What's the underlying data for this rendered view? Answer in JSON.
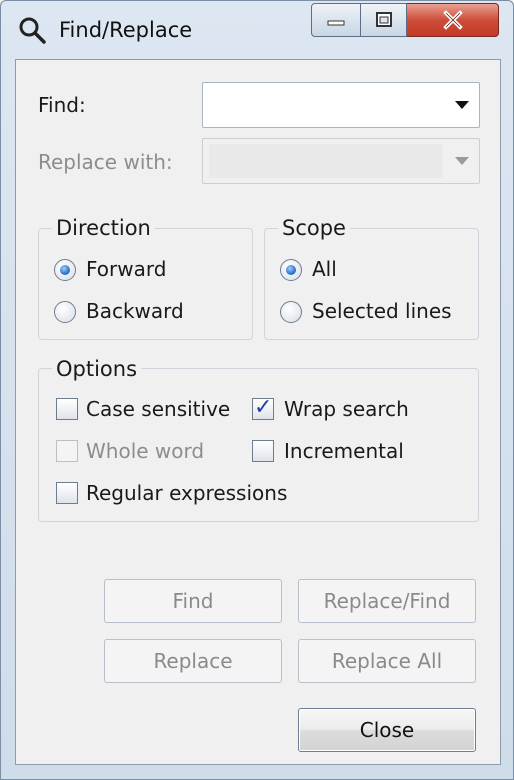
{
  "window": {
    "title": "Find/Replace",
    "title_icon": "search-icon",
    "caption_buttons": [
      "minimize-icon",
      "maximize-icon",
      "close-icon"
    ]
  },
  "find": {
    "label": "Find:",
    "value": ""
  },
  "replace": {
    "label": "Replace with:",
    "value": ""
  },
  "direction": {
    "title": "Direction",
    "options": [
      {
        "label": "Forward",
        "checked": true
      },
      {
        "label": "Backward",
        "checked": false
      }
    ]
  },
  "scope": {
    "title": "Scope",
    "options": [
      {
        "label": "All",
        "checked": true
      },
      {
        "label": "Selected lines",
        "checked": false
      }
    ]
  },
  "options": {
    "title": "Options",
    "items": [
      {
        "label": "Case sensitive",
        "checked": false,
        "enabled": true
      },
      {
        "label": "Wrap search",
        "checked": true,
        "enabled": true
      },
      {
        "label": "Whole word",
        "checked": false,
        "enabled": false
      },
      {
        "label": "Incremental",
        "checked": false,
        "enabled": true
      },
      {
        "label": "Regular expressions",
        "checked": false,
        "enabled": true
      }
    ]
  },
  "buttons": {
    "find": "Find",
    "replace_find": "Replace/Find",
    "replace": "Replace",
    "replace_all": "Replace All",
    "close": "Close"
  },
  "colors": {
    "close_caption": "#c23a26",
    "radio_dot": "#2d75c8",
    "check_tick": "#2b3fa0"
  }
}
